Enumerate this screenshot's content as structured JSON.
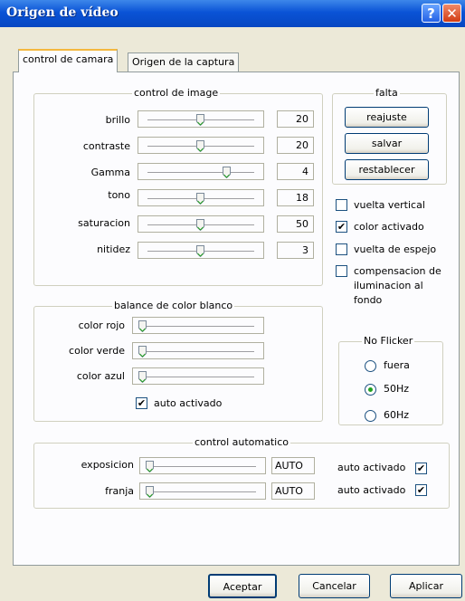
{
  "window": {
    "title": "Origen de vídeo",
    "help_glyph": "?",
    "close_glyph": "✕"
  },
  "tabs": [
    {
      "label": "control de camara",
      "active": true
    },
    {
      "label": "Origen de la captura",
      "active": false
    }
  ],
  "image_control": {
    "title": "control de image",
    "rows": [
      {
        "label": "brillo",
        "value": "20",
        "level": 0.5
      },
      {
        "label": "contraste",
        "value": "20",
        "level": 0.5
      },
      {
        "label": "Gamma",
        "value": "4",
        "level": 0.75
      },
      {
        "label": "tono",
        "value": "18",
        "level": 0.5
      },
      {
        "label": "saturacion",
        "value": "50",
        "level": 0.5
      },
      {
        "label": "nitidez",
        "value": "3",
        "level": 0.5
      }
    ]
  },
  "defaults_group": {
    "title": "falta",
    "buttons": [
      "reajuste",
      "salvar",
      "restablecer"
    ]
  },
  "checkboxes": [
    {
      "label": "vuelta vertical",
      "checked": false
    },
    {
      "label": "color activado",
      "checked": true
    },
    {
      "label": "vuelta de espejo",
      "checked": false
    },
    {
      "label": "compensacion de iluminacion al fondo",
      "checked": false
    }
  ],
  "white_balance": {
    "title": "balance de color blanco",
    "rows": [
      {
        "label": "color rojo",
        "level": 0.0
      },
      {
        "label": "color verde",
        "level": 0.0
      },
      {
        "label": "color azul",
        "level": 0.0
      }
    ],
    "auto_label": "auto activado",
    "auto_checked": true
  },
  "flicker": {
    "title": "No Flicker",
    "options": [
      "fuera",
      "50Hz",
      "60Hz"
    ],
    "selected": "50Hz"
  },
  "auto_control": {
    "title": "control automatico",
    "rows": [
      {
        "label": "exposicion",
        "value": "AUTO",
        "auto_label": "auto activado",
        "auto_checked": true,
        "level": 0.0
      },
      {
        "label": "franja",
        "value": "AUTO",
        "auto_label": "auto activado",
        "auto_checked": true,
        "level": 0.0
      }
    ]
  },
  "footer": {
    "ok": "Aceptar",
    "cancel": "Cancelar",
    "apply": "Aplicar"
  },
  "check_glyph": "✔"
}
